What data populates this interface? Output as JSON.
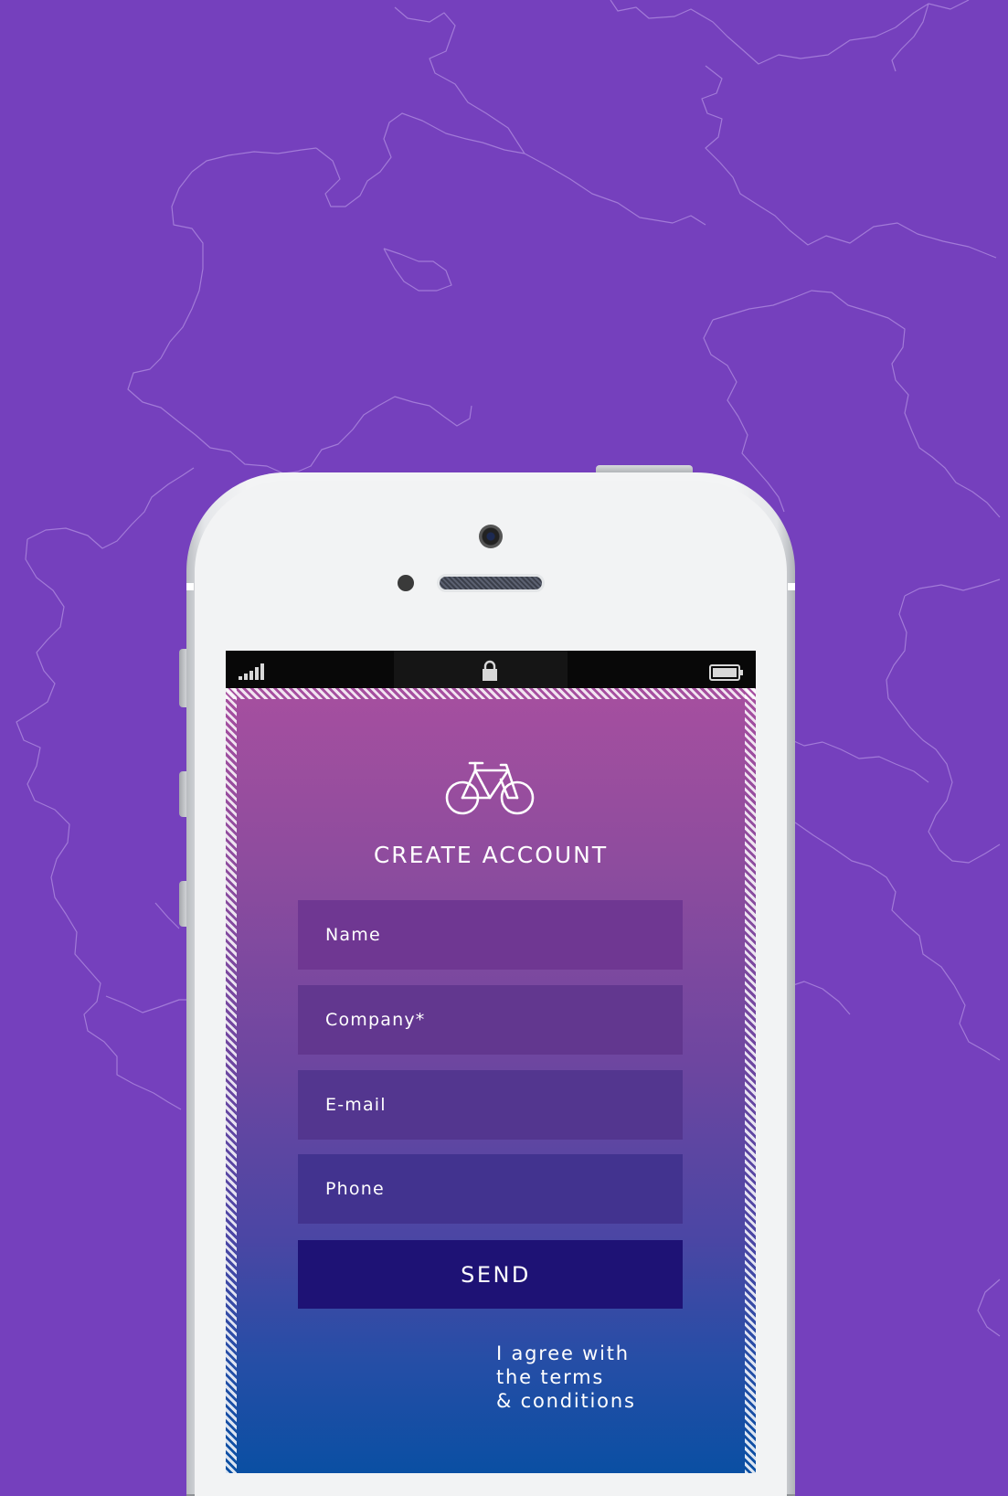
{
  "status_bar": {
    "signal_icon": "signal-bars-icon",
    "lock_icon": "lock-icon",
    "battery_icon": "battery-icon"
  },
  "app": {
    "logo_icon": "bicycle-icon",
    "title": "CREATE ACCOUNT",
    "fields": {
      "name_placeholder": "Name",
      "company_placeholder": "Company*",
      "email_placeholder": "E-mail",
      "phone_placeholder": "Phone"
    },
    "send_label": "SEND",
    "terms_text": "I agree with\nthe terms\n& conditions"
  },
  "colors": {
    "background": "#7540bd",
    "gradient_top": "#a64f9f",
    "gradient_bottom": "#0a4fa3",
    "send_button": "#1e1275"
  }
}
